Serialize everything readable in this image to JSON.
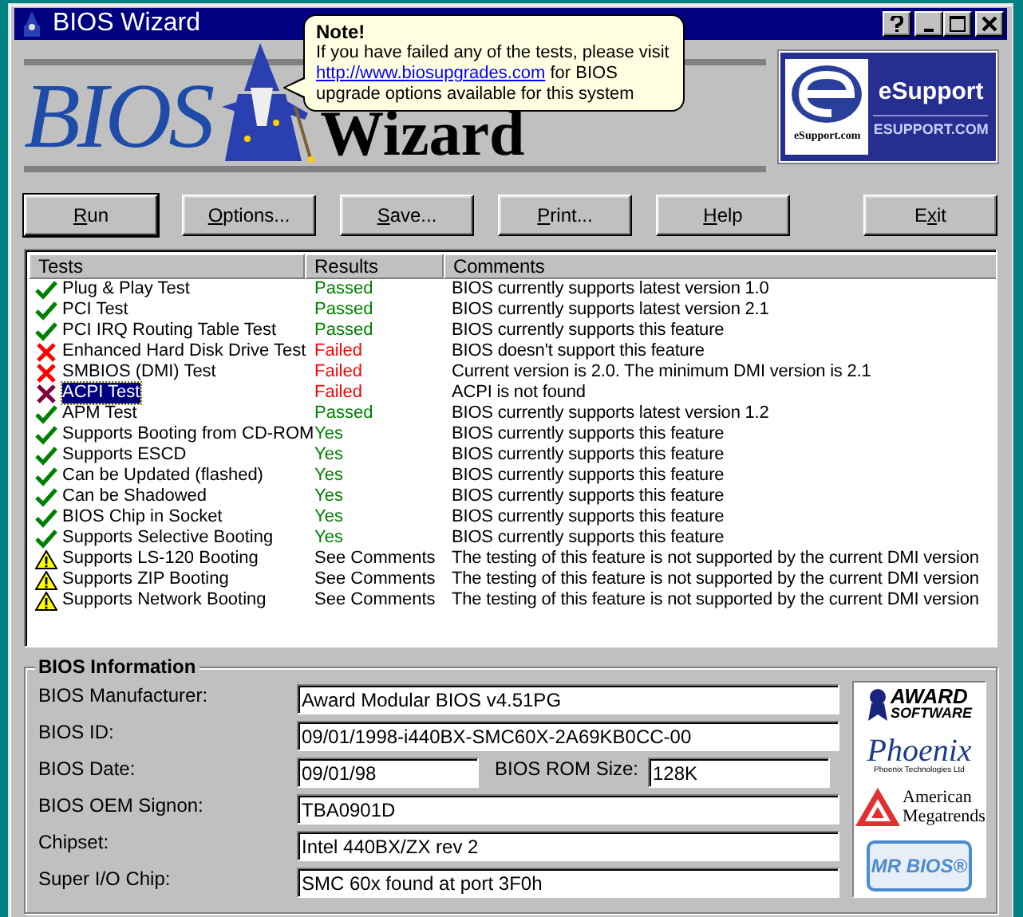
{
  "window": {
    "title": "BIOS Wizard"
  },
  "banner": {
    "logo_words": [
      "BIOS",
      "Wizard"
    ],
    "note": {
      "title": "Note!",
      "text_before": "If you have failed any of the tests, please visit",
      "link": "http://www.biosupgrades.com",
      "text_after": "for BIOS upgrade options available for this system"
    },
    "esupport": {
      "mark": "eSupport.com",
      "name": "eSupport",
      "url": "ESUPPORT.COM"
    }
  },
  "buttons": [
    {
      "key": "R",
      "after": "un",
      "default": true
    },
    {
      "key": "O",
      "after": "ptions...",
      "default": false
    },
    {
      "key": "S",
      "after": "ave...",
      "default": false
    },
    {
      "key": "P",
      "after": "rint...",
      "default": false
    },
    {
      "key": "H",
      "after": "elp",
      "default": false
    },
    {
      "before": "E",
      "key": "x",
      "after": "it",
      "default": false
    }
  ],
  "table": {
    "columns": [
      "Tests",
      "Results",
      "Comments"
    ],
    "rows": [
      {
        "kind": "pass",
        "test": "Plug & Play Test",
        "result": "Passed",
        "comment": "BIOS currently supports latest version 1.0",
        "selected": false
      },
      {
        "kind": "pass",
        "test": "PCI Test",
        "result": "Passed",
        "comment": "BIOS currently supports latest version 2.1",
        "selected": false
      },
      {
        "kind": "pass",
        "test": "PCI IRQ Routing Table Test",
        "result": "Passed",
        "comment": "BIOS currently supports this feature",
        "selected": false
      },
      {
        "kind": "fail",
        "test": "Enhanced Hard Disk Drive Test",
        "result": "Failed",
        "comment": "BIOS doesn't support this feature",
        "selected": false
      },
      {
        "kind": "fail",
        "test": "SMBIOS (DMI) Test",
        "result": "Failed",
        "comment": "Current version is 2.0. The minimum DMI version is 2.1",
        "selected": false
      },
      {
        "kind": "fail",
        "test": "ACPI Test",
        "result": "Failed",
        "comment": "ACPI is not found",
        "selected": true
      },
      {
        "kind": "pass",
        "test": "APM Test",
        "result": "Passed",
        "comment": "BIOS currently supports latest version 1.2",
        "selected": false
      },
      {
        "kind": "pass",
        "test": "Supports Booting from CD-ROM",
        "result": "Yes",
        "comment": "BIOS currently supports this feature",
        "selected": false
      },
      {
        "kind": "pass",
        "test": "Supports ESCD",
        "result": "Yes",
        "comment": "BIOS currently supports this feature",
        "selected": false
      },
      {
        "kind": "pass",
        "test": "Can be Updated (flashed)",
        "result": "Yes",
        "comment": "BIOS currently supports this feature",
        "selected": false
      },
      {
        "kind": "pass",
        "test": "Can be Shadowed",
        "result": "Yes",
        "comment": "BIOS currently supports this feature",
        "selected": false
      },
      {
        "kind": "pass",
        "test": "BIOS Chip in Socket",
        "result": "Yes",
        "comment": "BIOS currently supports this feature",
        "selected": false
      },
      {
        "kind": "pass",
        "test": "Supports Selective Booting",
        "result": "Yes",
        "comment": "BIOS currently supports this feature",
        "selected": false
      },
      {
        "kind": "warn",
        "test": "Supports LS-120 Booting",
        "result": "See Comments",
        "comment": "The testing of this feature is not supported by the current DMI version",
        "selected": false
      },
      {
        "kind": "warn",
        "test": "Supports ZIP Booting",
        "result": "See Comments",
        "comment": "The testing of this feature is not supported by the current DMI version",
        "selected": false
      },
      {
        "kind": "warn",
        "test": "Supports Network Booting",
        "result": "See Comments",
        "comment": "The testing of this feature is not supported by the current DMI version",
        "selected": false
      }
    ]
  },
  "bios_info": {
    "title": "BIOS Information",
    "rows": [
      {
        "fields": [
          {
            "label": "BIOS Manufacturer:",
            "value": "Award Modular BIOS v4.51PG"
          }
        ]
      },
      {
        "fields": [
          {
            "label": "BIOS ID:",
            "value": "09/01/1998-i440BX-SMC60X-2A69KB0CC-00"
          }
        ]
      },
      {
        "fields": [
          {
            "label": "BIOS Date:",
            "value": "09/01/98"
          },
          {
            "label": "BIOS ROM Size:",
            "value": "128K"
          }
        ]
      },
      {
        "fields": [
          {
            "label": "BIOS OEM Signon:",
            "value": "TBA0901D"
          }
        ]
      },
      {
        "fields": [
          {
            "label": "Chipset:",
            "value": "Intel 440BX/ZX rev 2"
          }
        ]
      },
      {
        "fields": [
          {
            "label": "Super I/O Chip:",
            "value": "SMC 60x found at port 3F0h"
          }
        ]
      }
    ],
    "vendors": [
      {
        "kind": "award",
        "lines": [
          "AWARD",
          "SOFTWARE"
        ]
      },
      {
        "kind": "phoenix",
        "lines": [
          "Phoenix",
          "Phoenix Technologies Ltd"
        ]
      },
      {
        "kind": "ami",
        "lines": [
          "American",
          "Megatrends"
        ]
      },
      {
        "kind": "mrbios",
        "lines": [
          "MR BIOS®"
        ]
      }
    ]
  }
}
